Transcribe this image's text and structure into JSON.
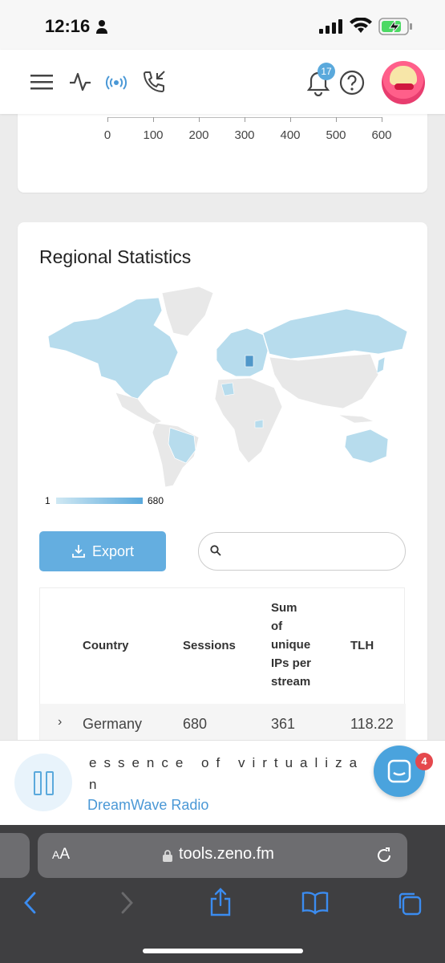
{
  "status_bar": {
    "time": "12:16"
  },
  "header": {
    "notification_count": "17"
  },
  "chart_axis": {
    "ticks": [
      "0",
      "100",
      "200",
      "300",
      "400",
      "500",
      "600"
    ]
  },
  "regional": {
    "title": "Regional Statistics",
    "legend_min": "1",
    "legend_max": "680",
    "export_label": "Export",
    "search_placeholder": "",
    "table": {
      "headers": {
        "country": "Country",
        "sessions": "Sessions",
        "unique_ips": [
          "Sum",
          "of",
          "unique",
          "IPs per",
          "stream"
        ],
        "tlh": "TLH"
      },
      "rows": [
        {
          "country": "Germany",
          "sessions": "680",
          "unique_ips": "361",
          "tlh": "118.22"
        }
      ]
    },
    "colors": {
      "highlight": "#a9d6ea",
      "strong": "#4f97c9",
      "base": "#e8e8e8"
    }
  },
  "player": {
    "track_line1": "essence of virtualiza",
    "track_line2": "n",
    "station": "DreamWave Radio",
    "chat_badge": "4"
  },
  "browser": {
    "text_size_label": "A",
    "text_size_label_big": "A",
    "domain": "tools.zeno.fm"
  }
}
